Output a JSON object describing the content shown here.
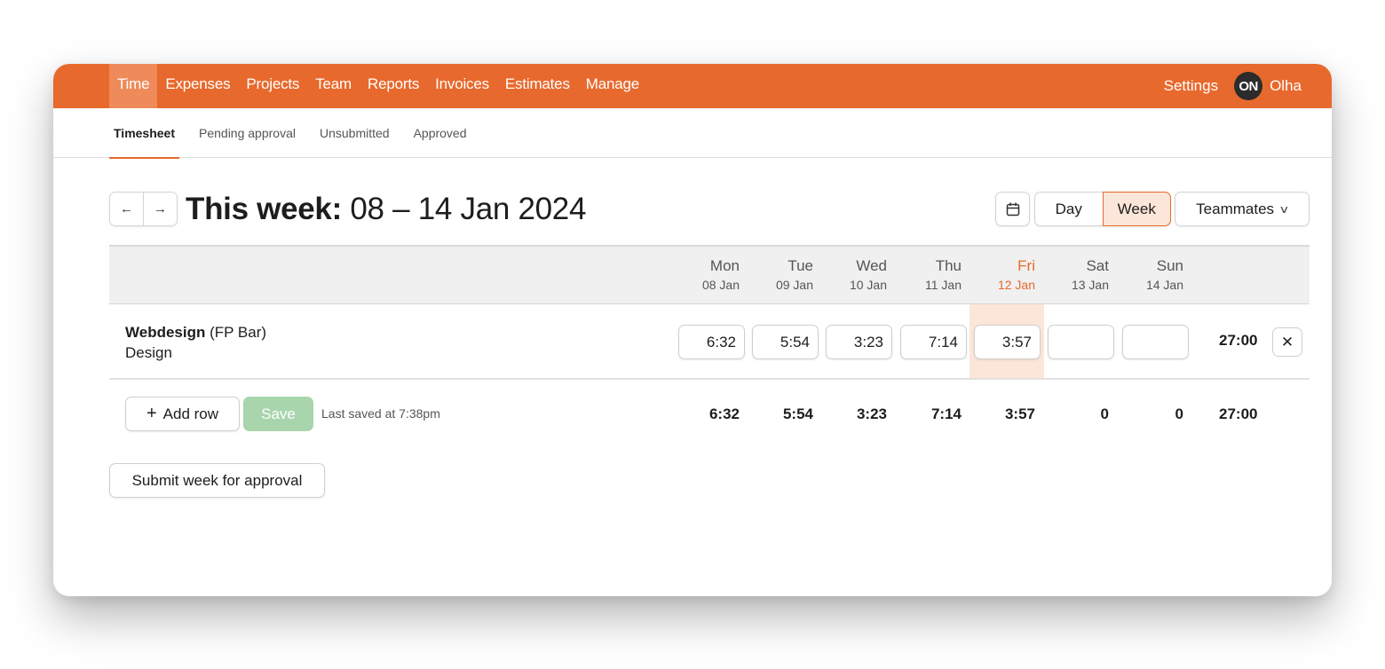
{
  "nav": {
    "items": [
      {
        "label": "Time",
        "active": true
      },
      {
        "label": "Expenses"
      },
      {
        "label": "Projects"
      },
      {
        "label": "Team"
      },
      {
        "label": "Reports"
      },
      {
        "label": "Invoices"
      },
      {
        "label": "Estimates"
      },
      {
        "label": "Manage"
      }
    ],
    "settings_label": "Settings",
    "avatar_initials": "ON",
    "user_name": "Olha"
  },
  "subnav": {
    "tabs": [
      {
        "label": "Timesheet",
        "active": true
      },
      {
        "label": "Pending approval"
      },
      {
        "label": "Unsubmitted"
      },
      {
        "label": "Approved"
      }
    ]
  },
  "header": {
    "prev_icon": "arrow-left-icon",
    "next_icon": "arrow-right-icon",
    "title_prefix": "This week:",
    "title_range": "08 – 14 Jan 2024",
    "calendar_icon": "calendar-icon",
    "view_day": "Day",
    "view_week": "Week",
    "active_view": "Week",
    "teammates_label": "Teammates",
    "teammates_icon": "chevron-down-icon"
  },
  "days": [
    {
      "name": "Mon",
      "date": "08 Jan"
    },
    {
      "name": "Tue",
      "date": "09 Jan"
    },
    {
      "name": "Wed",
      "date": "10 Jan"
    },
    {
      "name": "Thu",
      "date": "11 Jan"
    },
    {
      "name": "Fri",
      "date": "12 Jan",
      "today": true
    },
    {
      "name": "Sat",
      "date": "13 Jan"
    },
    {
      "name": "Sun",
      "date": "14 Jan"
    }
  ],
  "rows": [
    {
      "project": "Webdesign",
      "client": "(FP Bar)",
      "task": "Design",
      "entries": [
        "6:32",
        "5:54",
        "3:23",
        "7:14",
        "3:57",
        "",
        ""
      ],
      "total": "27:00",
      "remove_icon": "close-icon"
    }
  ],
  "footer": {
    "add_row_label": "Add row",
    "save_label": "Save",
    "last_saved": "Last saved at 7:38pm",
    "day_totals": [
      "6:32",
      "5:54",
      "3:23",
      "7:14",
      "3:57",
      "0",
      "0"
    ],
    "grand_total": "27:00"
  },
  "submit_label": "Submit week for approval",
  "colors": {
    "brand": "#e8692d",
    "today_highlight": "#fce6d9",
    "save_disabled": "#a8d5ac"
  }
}
